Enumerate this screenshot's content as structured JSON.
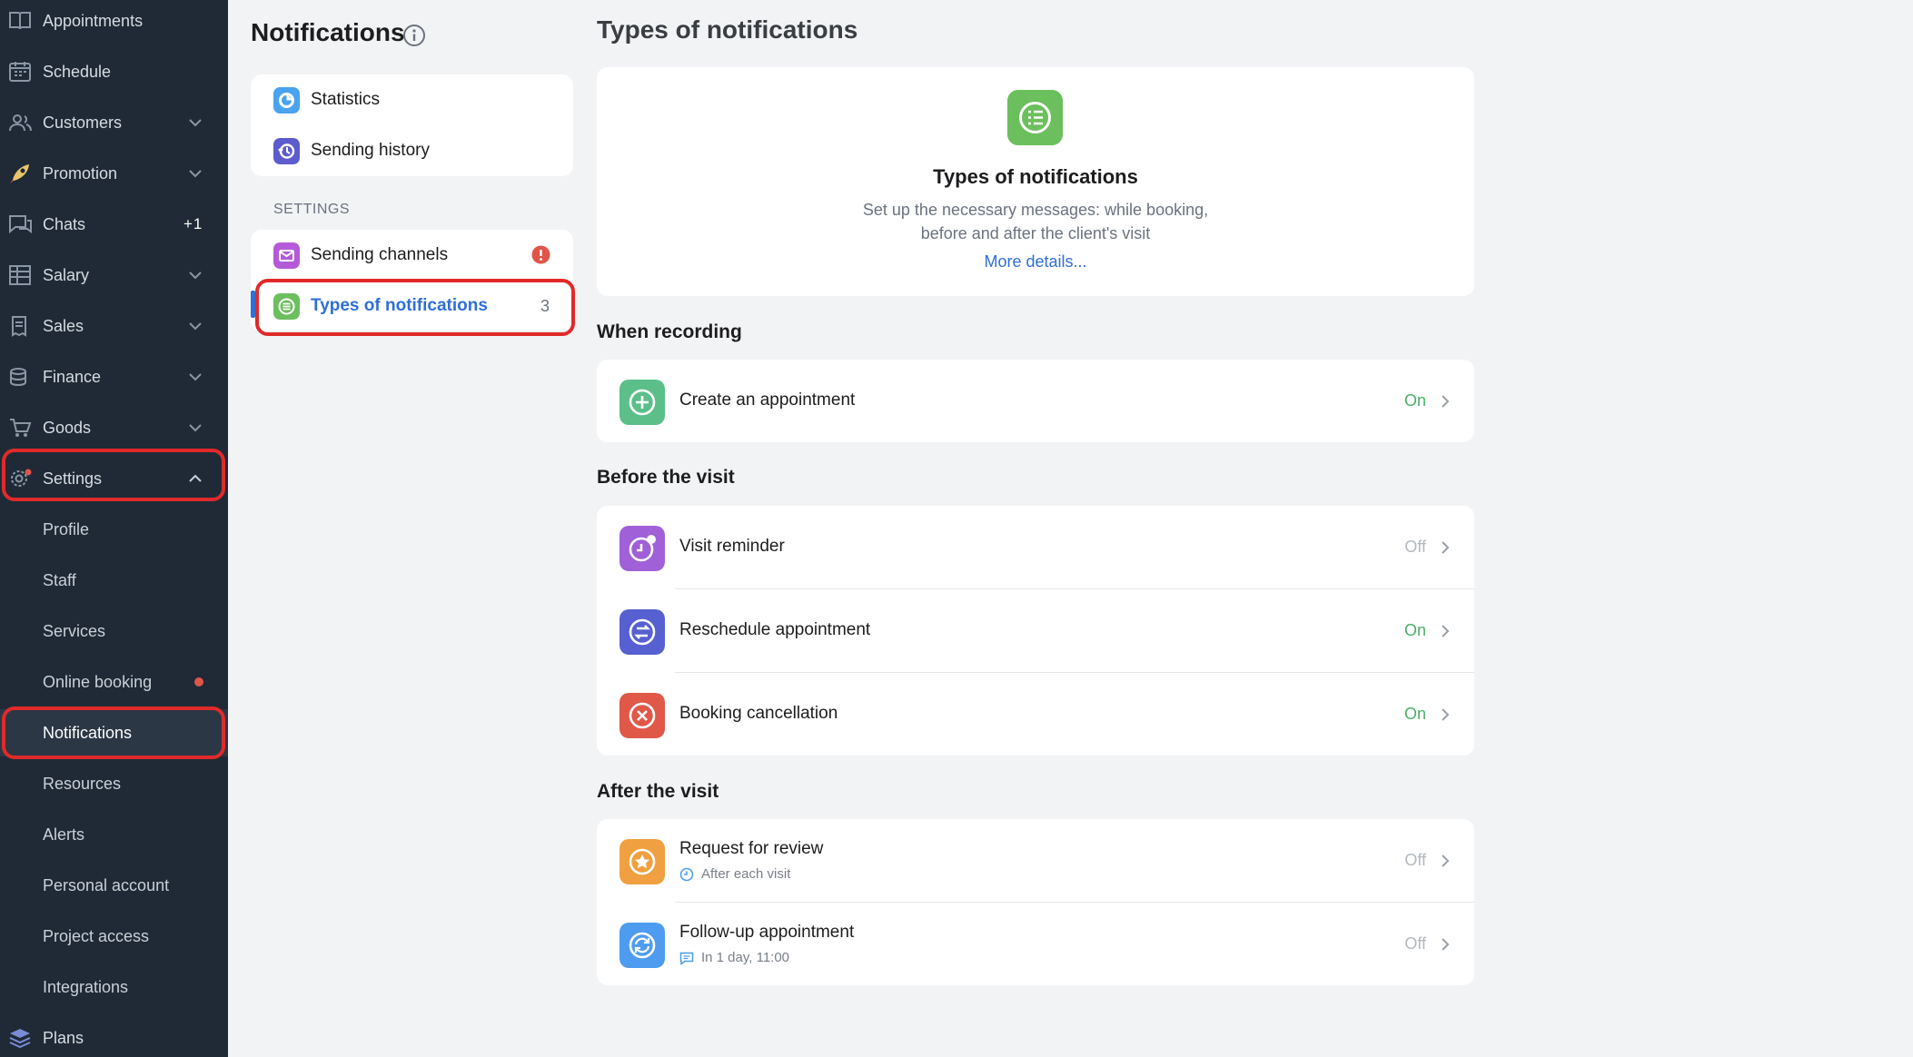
{
  "sidebar": {
    "items": [
      {
        "label": "Appointments",
        "icon": "appointments-book-icon"
      },
      {
        "label": "Schedule",
        "icon": "calendar-icon"
      },
      {
        "label": "Customers",
        "icon": "customers-icon",
        "chevron": "down"
      },
      {
        "label": "Promotion",
        "icon": "rocket-icon",
        "chevron": "down"
      },
      {
        "label": "Chats",
        "icon": "chat-icon",
        "count": "+1"
      },
      {
        "label": "Salary",
        "icon": "salary-table-icon",
        "chevron": "down"
      },
      {
        "label": "Sales",
        "icon": "sales-receipt-icon",
        "chevron": "down"
      },
      {
        "label": "Finance",
        "icon": "finance-coins-icon",
        "chevron": "down"
      },
      {
        "label": "Goods",
        "icon": "goods-cart-icon",
        "chevron": "down"
      },
      {
        "label": "Settings",
        "icon": "gear-icon",
        "chevron": "up"
      }
    ],
    "settings_sub": [
      {
        "label": "Profile"
      },
      {
        "label": "Staff"
      },
      {
        "label": "Services"
      },
      {
        "label": "Online booking"
      },
      {
        "label": "Notifications"
      },
      {
        "label": "Resources"
      },
      {
        "label": "Alerts"
      },
      {
        "label": "Personal account"
      },
      {
        "label": "Project access"
      },
      {
        "label": "Integrations"
      }
    ],
    "plans_label": "Plans"
  },
  "middle": {
    "title": "Notifications",
    "top_items": [
      {
        "label": "Statistics",
        "icon": "statistics-icon"
      },
      {
        "label": "Sending history",
        "icon": "history-icon"
      }
    ],
    "settings_header": "SETTINGS",
    "settings_items": [
      {
        "label": "Sending channels",
        "icon": "envelope-icon"
      },
      {
        "label": "Types of notifications",
        "icon": "list-icon",
        "count": "3"
      }
    ]
  },
  "main": {
    "title": "Types of notifications",
    "hero": {
      "title": "Types of notifications",
      "desc_line1": "Set up the necessary messages: while booking,",
      "desc_line2": "before and after the client's visit",
      "link": "More details..."
    },
    "sections": [
      {
        "title": "When recording",
        "rows": [
          {
            "label": "Create an appointment",
            "status": "On",
            "icon": "plus-circle-icon",
            "color": "#5cbf8a"
          }
        ]
      },
      {
        "title": "Before the visit",
        "rows": [
          {
            "label": "Visit reminder",
            "status": "Off",
            "icon": "clock-reminder-icon",
            "color": "#a060d8"
          },
          {
            "label": "Reschedule appointment",
            "status": "On",
            "icon": "reschedule-arrows-icon",
            "color": "#5660d0"
          },
          {
            "label": "Booking cancellation",
            "status": "On",
            "icon": "cancel-x-icon",
            "color": "#e05848"
          }
        ]
      },
      {
        "title": "After the visit",
        "rows": [
          {
            "label": "Request for review",
            "status": "Off",
            "sub": "After each visit",
            "icon": "star-icon",
            "color": "#f0a040"
          },
          {
            "label": "Follow-up appointment",
            "status": "Off",
            "sub": "In 1 day, 11:00",
            "icon": "refresh-icon",
            "color": "#4d9cf0"
          }
        ]
      }
    ]
  },
  "colors": {
    "sidebar_bg": "#1f2a36",
    "accent_blue": "#2f6fd6",
    "on_green": "#4caf6a",
    "highlight_red": "#e02a2a"
  }
}
